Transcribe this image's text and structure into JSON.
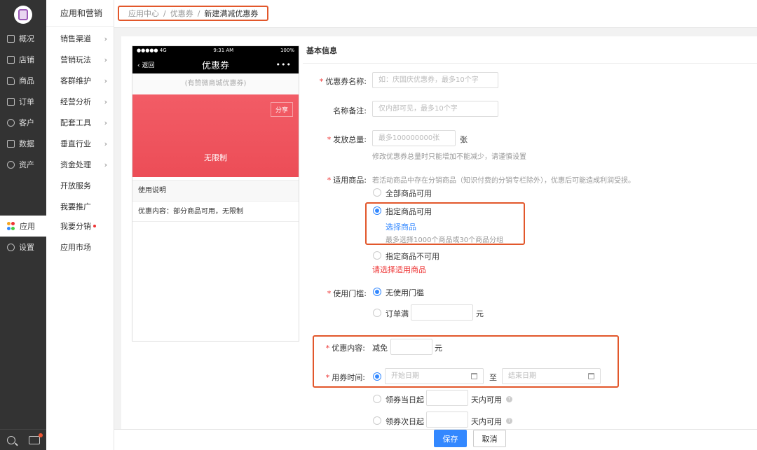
{
  "sidebar_main": {
    "items": [
      {
        "label": "概况",
        "icon": "overview-icon"
      },
      {
        "label": "店铺",
        "icon": "store-icon"
      },
      {
        "label": "商品",
        "icon": "tag-icon"
      },
      {
        "label": "订单",
        "icon": "order-icon"
      },
      {
        "label": "客户",
        "icon": "customer-icon"
      },
      {
        "label": "数据",
        "icon": "chart-icon"
      },
      {
        "label": "资产",
        "icon": "asset-icon"
      },
      {
        "label": "应用",
        "icon": "apps-icon",
        "active": true
      },
      {
        "label": "设置",
        "icon": "gear-icon"
      }
    ]
  },
  "sidebar_sub": {
    "title": "应用和营销",
    "items": [
      {
        "label": "销售渠道",
        "chevron": "›"
      },
      {
        "label": "营销玩法",
        "chevron": "›"
      },
      {
        "label": "客群维护",
        "chevron": "›"
      },
      {
        "label": "经营分析",
        "chevron": "›"
      },
      {
        "label": "配套工具",
        "chevron": "›"
      },
      {
        "label": "垂直行业",
        "chevron": "›"
      },
      {
        "label": "资金处理",
        "chevron": "›"
      },
      {
        "label": "开放服务"
      },
      {
        "label": "我要推广"
      },
      {
        "label": "我要分销",
        "dot": true
      },
      {
        "label": "应用市场"
      }
    ]
  },
  "breadcrumb": {
    "items": [
      "应用中心",
      "优惠券",
      "新建满减优惠券"
    ],
    "separator": "/"
  },
  "preview": {
    "status": {
      "signal": "●●●●● 4G",
      "time": "9:31 AM",
      "battery": "100%"
    },
    "back_label": "返回",
    "title": "优惠券",
    "more": "•••",
    "shop_name": "(有赞微商城优惠券)",
    "share_label": "分享",
    "coupon_text": "无限制",
    "instructions_title": "使用说明",
    "instructions_detail": "优惠内容：部分商品可用，无限制"
  },
  "form": {
    "section_title": "基本信息",
    "name": {
      "label": "优惠券名称:",
      "required": "*",
      "placeholder": "如：庆国庆优惠券，最多10个字"
    },
    "remark": {
      "label": "名称备注:",
      "placeholder": "仅内部可见，最多10个字"
    },
    "quantity": {
      "label": "发放总量:",
      "required": "*",
      "placeholder": "最多100000000张",
      "unit": "张",
      "hint": "修改优惠券总量时只能增加不能减少，请谨慎设置"
    },
    "goods": {
      "label": "适用商品:",
      "required": "*",
      "hint": "若活动商品中存在分销商品（知识付费的分销专栏除外），优惠后可能造成利润受损。",
      "option_all": "全部商品可用",
      "option_specified": "指定商品可用",
      "select_link": "选择商品",
      "select_hint": "最多选择1000个商品或30个商品分组",
      "option_excluded": "指定商品不可用",
      "error": "请选择适用商品"
    },
    "threshold": {
      "label": "使用门槛:",
      "required": "*",
      "option_none": "无使用门槛",
      "option_min": "订单满",
      "unit": "元"
    },
    "discount": {
      "label": "优惠内容:",
      "required": "*",
      "prefix": "减免",
      "unit": "元"
    },
    "period": {
      "label": "用券时间:",
      "required": "*",
      "start_placeholder": "开始日期",
      "to": "至",
      "end_placeholder": "结束日期",
      "option_same_day": "领券当日起",
      "option_next_day": "领券次日起",
      "days_unit": "天内可用",
      "help": "?"
    }
  },
  "actions": {
    "save": "保存",
    "cancel": "取消"
  },
  "colors": {
    "accent": "#3388ff",
    "highlight": "#e2572b",
    "coupon": "#ef5560",
    "sidebar": "#333333"
  }
}
